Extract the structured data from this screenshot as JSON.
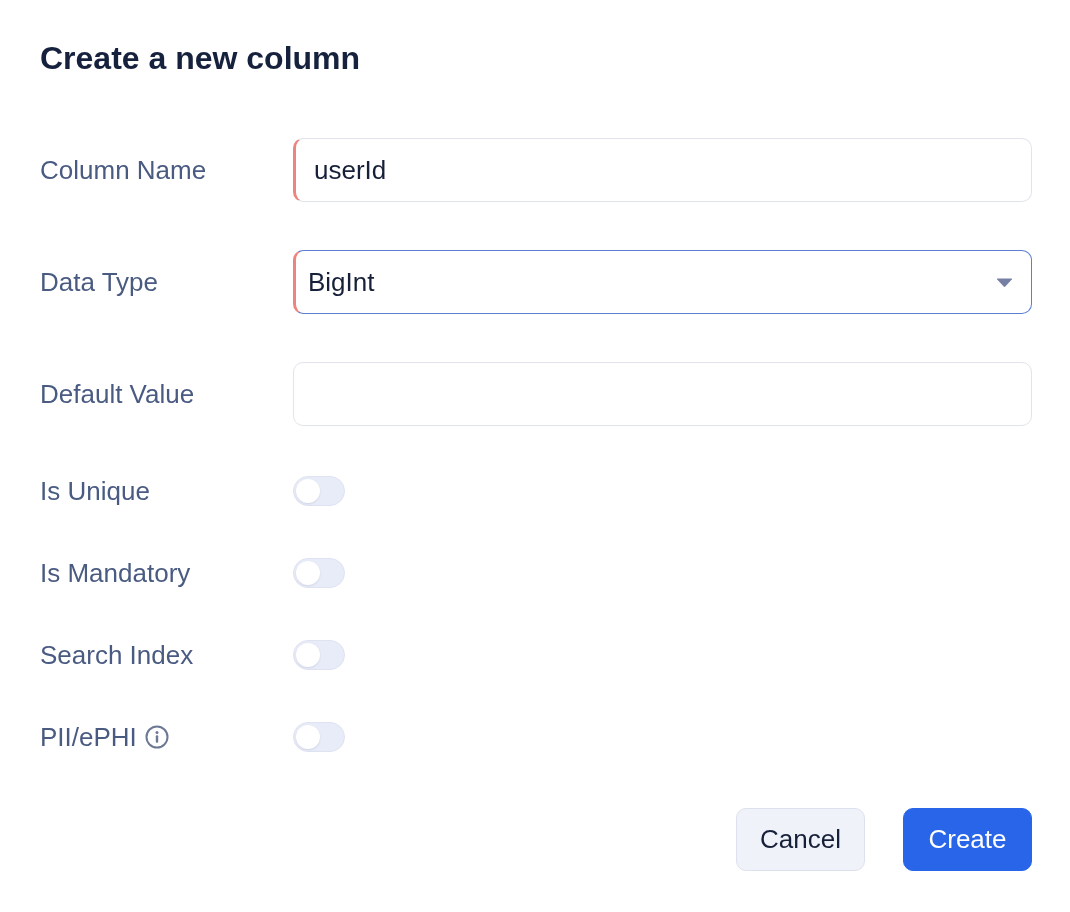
{
  "dialog": {
    "title": "Create a new column"
  },
  "fields": [
    {
      "kind": "text",
      "label": "Column Name",
      "value": "userId",
      "required": true,
      "focused": false
    },
    {
      "kind": "select",
      "label": "Data Type",
      "value": "BigInt",
      "required": true,
      "focused": true
    },
    {
      "kind": "text",
      "label": "Default Value",
      "required": false,
      "focused": false
    }
  ],
  "toggles": [
    {
      "label": "Is Unique",
      "on": false,
      "info": false
    },
    {
      "label": "Is Mandatory",
      "on": false,
      "info": false
    },
    {
      "label": "Search Index",
      "on": false,
      "info": false
    },
    {
      "label": "PII/ePHI",
      "on": false,
      "info": true
    }
  ],
  "buttons": [
    {
      "kind": "secondary",
      "label": "Cancel"
    },
    {
      "kind": "primary",
      "label": "Create"
    }
  ]
}
